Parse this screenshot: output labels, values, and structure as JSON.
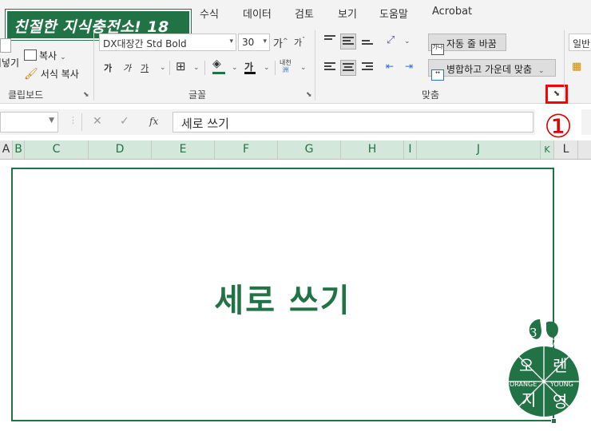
{
  "brand": {
    "title": "친절한 지식충전소! 18"
  },
  "tabs": [
    "수식",
    "데이터",
    "검토",
    "보기",
    "도움말",
    "Acrobat"
  ],
  "clipboard": {
    "paste_partial": "붙여넣기",
    "copy_label": "복사",
    "format_painter_label": "서식 복사",
    "group_label": "클립보드"
  },
  "font": {
    "font_name": "DX대장간 Std Bold",
    "font_size": "30",
    "grow_glyph": "가",
    "shrink_glyph": "가",
    "bold_glyph": "가",
    "italic_glyph": "가",
    "underline_glyph": "가",
    "font_color_glyph": "가",
    "phonetic_top": "내천",
    "phonetic_bottom": "洲",
    "group_label": "글꼴"
  },
  "alignment": {
    "wrap_text_label": "자동 줄 바꿈",
    "wrap_icon_text": "가나",
    "merge_center_label": "병합하고 가운데 맞춤",
    "group_label": "맞춤"
  },
  "number": {
    "format_partial": "일반"
  },
  "formula_bar": {
    "fx": "fx",
    "content": "세로 쓰기"
  },
  "annotation": {
    "step": "①"
  },
  "columns": [
    "A",
    "B",
    "C",
    "D",
    "E",
    "F",
    "G",
    "H",
    "I",
    "J",
    "K",
    "L"
  ],
  "cell": {
    "text": "세로 쓰기"
  },
  "logo": {
    "number_left": "3",
    "number_right": "7",
    "char_top_left": "오",
    "char_top_right": "렌",
    "band_left": "ORANGE",
    "band_right": "YOUNG",
    "char_bottom_left": "지",
    "char_bottom_right": "영"
  },
  "colors": {
    "accent": "#217346",
    "highlight": "#ff0000",
    "annotation": "#e00000"
  }
}
